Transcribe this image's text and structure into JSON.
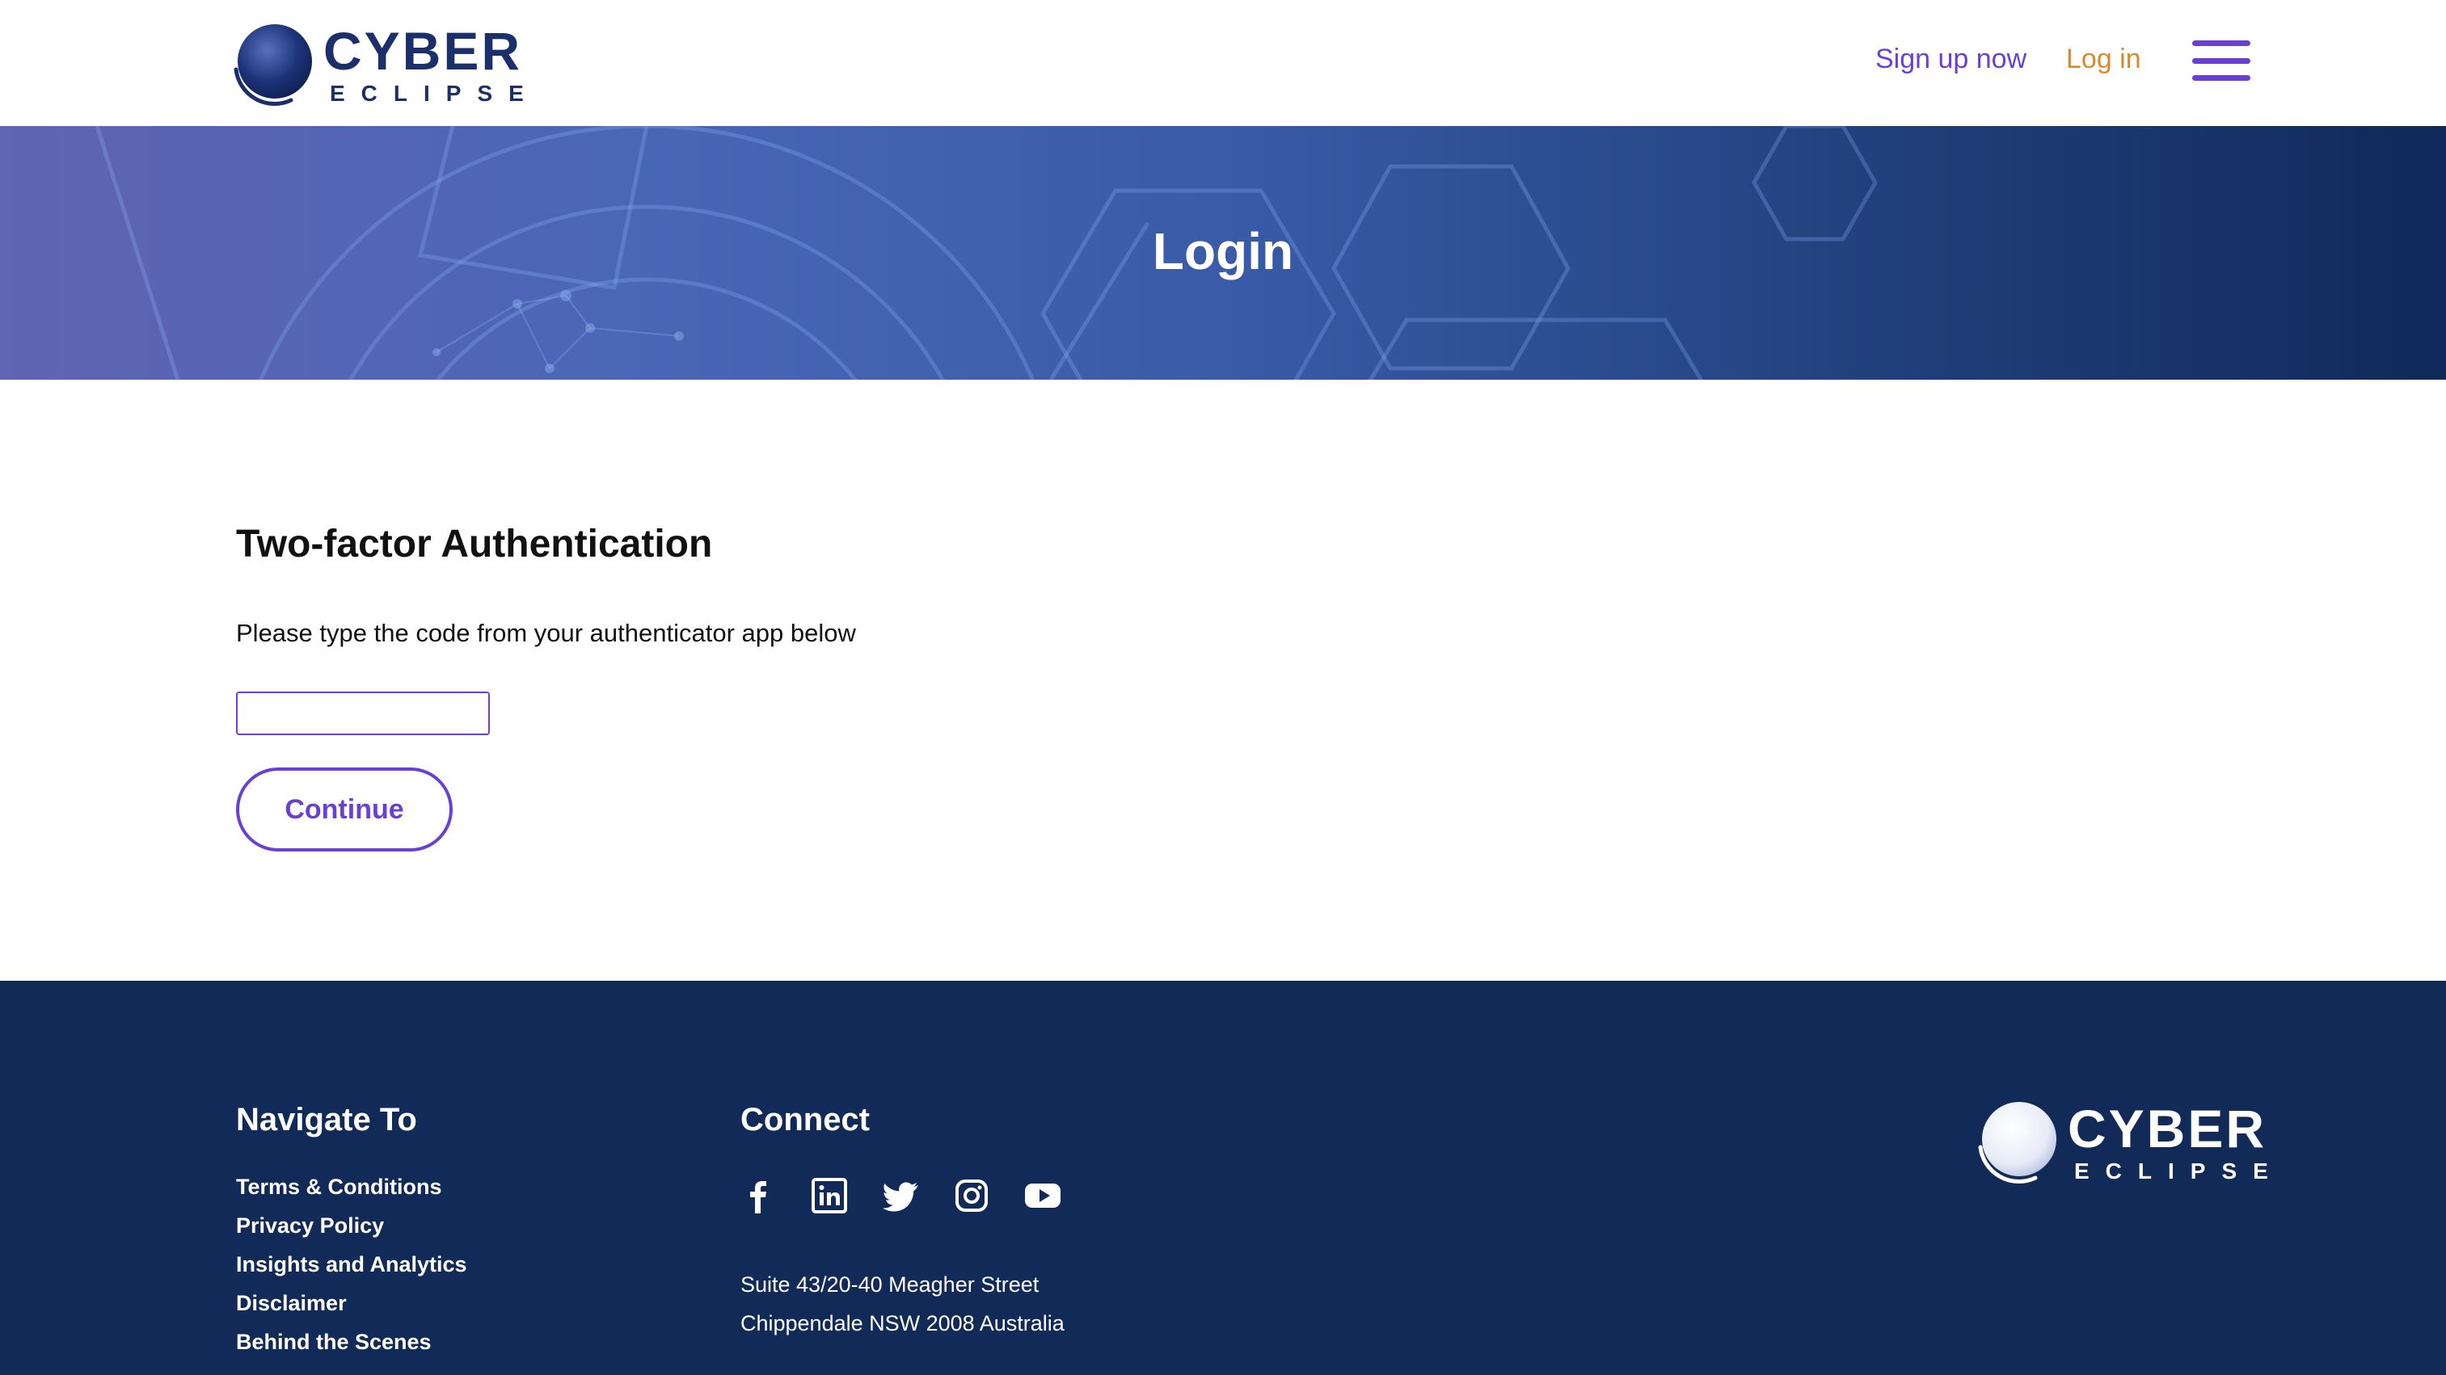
{
  "brand": {
    "name_line1": "CYBER",
    "name_line2": "ECLIPSE",
    "color_primary": "#1b2f6b",
    "color_accent": "#6a3fd6",
    "color_login": "#d98a2b"
  },
  "header": {
    "signup_label": "Sign up now",
    "login_label": "Log in",
    "menu_icon": "hamburger-menu-icon"
  },
  "banner": {
    "title": "Login"
  },
  "main": {
    "heading": "Two-factor Authentication",
    "description": "Please type the code from your authenticator app below",
    "code_value": "",
    "continue_label": "Continue"
  },
  "footer": {
    "navigate_heading": "Navigate To",
    "links": [
      "Terms & Conditions",
      "Privacy Policy",
      "Insights and Analytics",
      "Disclaimer",
      "Behind the Scenes"
    ],
    "connect_heading": "Connect",
    "social_icons": [
      "facebook-icon",
      "linkedin-icon",
      "twitter-icon",
      "instagram-icon",
      "youtube-icon"
    ],
    "address_line1": "Suite 43/20-40 Meagher Street",
    "address_line2": "Chippendale NSW 2008 Australia",
    "background_color": "#122a58"
  }
}
